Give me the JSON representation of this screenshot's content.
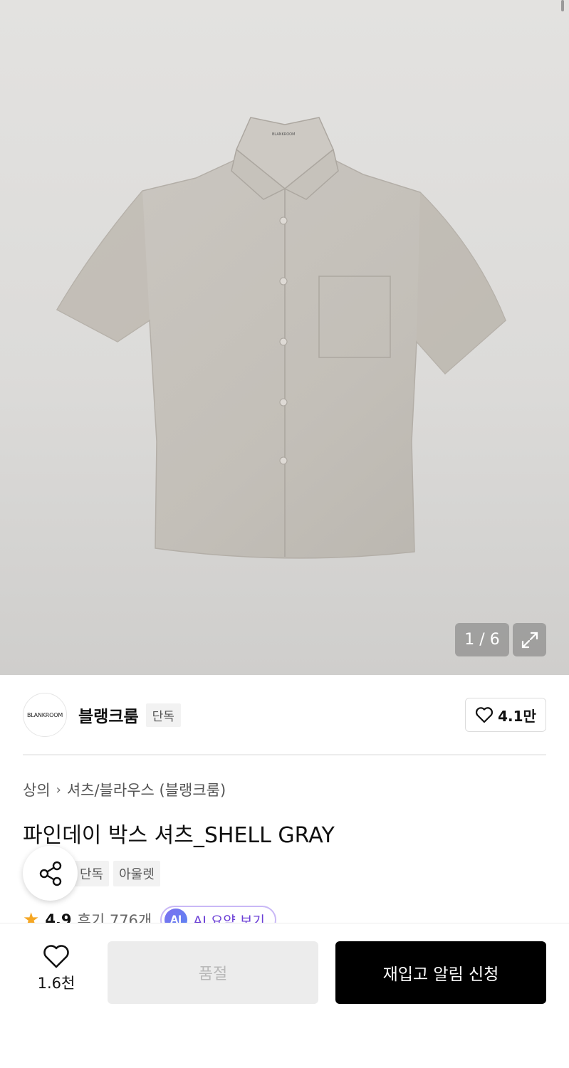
{
  "gallery": {
    "counter": "1 / 6",
    "shirt_label": "BLANKROOM",
    "icons": {
      "expand": "expand-icon"
    }
  },
  "brand": {
    "logo_text": "BLANKROOM",
    "name": "블랭크룸",
    "exclusive_tag": "단독",
    "likes": "4.1만"
  },
  "product": {
    "breadcrumb": [
      "상의",
      "셔츠/블라우스 (블랭크룸)"
    ],
    "title": "파인데이 박스 셔츠_SHELL GRAY",
    "tags": [
      "단독",
      "아울렛"
    ],
    "rating": "4.9",
    "reviews": "후기 776개",
    "ai_badge": "AI",
    "ai_summary": "AI 요약 보기"
  },
  "bottom_bar": {
    "like_count": "1.6천",
    "soldout_label": "품절",
    "restock_label": "재입고 알림 신청"
  },
  "colors": {
    "primary_button": "#000000",
    "soldout_button": "#ececec",
    "star": "#f5a623",
    "ai_accent": "#6b3fd6"
  }
}
